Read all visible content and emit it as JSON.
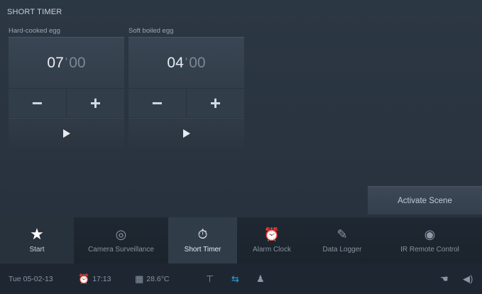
{
  "page": {
    "title": "SHORT TIMER"
  },
  "timers": [
    {
      "label": "Hard-cooked egg",
      "minutes": "07",
      "separator": "'",
      "seconds": "00",
      "minus": "−",
      "plus": "+"
    },
    {
      "label": "Soft boiled egg",
      "minutes": "04",
      "separator": "'",
      "seconds": "00",
      "minus": "−",
      "plus": "+"
    }
  ],
  "scene": {
    "button_label": "Activate Scene"
  },
  "tabs": [
    {
      "label": "Start",
      "icon": "star-icon",
      "glyph": "★"
    },
    {
      "label": "Camera Surveillance",
      "icon": "camera-icon",
      "glyph": "◎"
    },
    {
      "label": "Short Timer",
      "icon": "stopwatch-icon",
      "glyph": "⏱"
    },
    {
      "label": "Alarm Clock",
      "icon": "alarm-clock-icon",
      "glyph": "⏰"
    },
    {
      "label": "Data Logger",
      "icon": "data-logger-icon",
      "glyph": "✎"
    },
    {
      "label": "IR Remote Control",
      "icon": "eye-icon",
      "glyph": "◉"
    }
  ],
  "status": {
    "date": "Tue 05-02-13",
    "time": "17:13",
    "temperature": "28.6°C",
    "glyphs": {
      "clock": "⏰",
      "building": "▦",
      "pin": "⊤",
      "link": "⇆",
      "person": "♟",
      "hand": "☚",
      "speaker": "◀)"
    }
  },
  "colors": {
    "accent": "#2f9fe0",
    "background": "#2a3440",
    "tabbar": "#1f2832"
  }
}
